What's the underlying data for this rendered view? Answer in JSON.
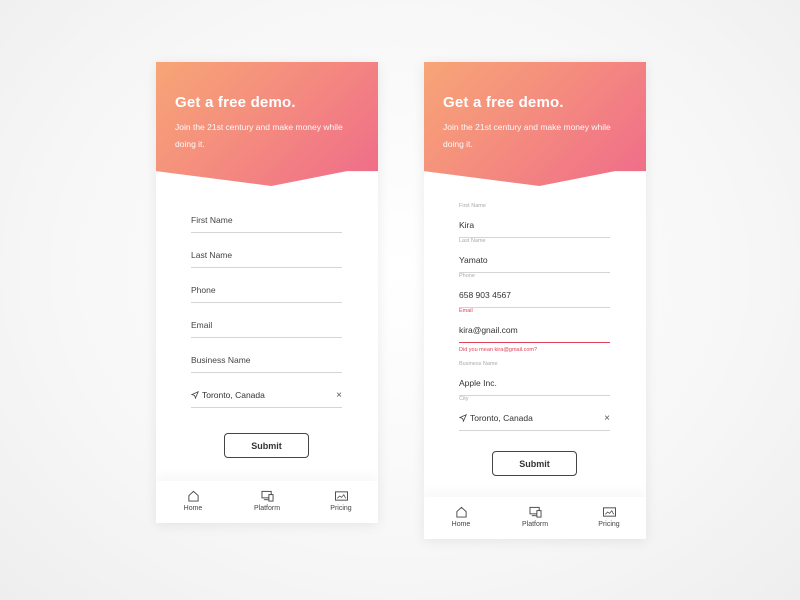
{
  "hero": {
    "title": "Get a free demo.",
    "subtitle": "Join the 21st century and make money while doing it."
  },
  "screen_a": {
    "fields": [
      {
        "placeholder": "First Name"
      },
      {
        "placeholder": "Last Name"
      },
      {
        "placeholder": "Phone"
      },
      {
        "placeholder": "Email"
      },
      {
        "placeholder": "Business Name"
      }
    ],
    "location": {
      "value": "Toronto, Canada",
      "clear": "×"
    },
    "submit": "Submit"
  },
  "screen_b": {
    "fields": [
      {
        "label": "First Name",
        "value": "Kira"
      },
      {
        "label": "Last Name",
        "value": "Yamato"
      },
      {
        "label": "Phone",
        "value": "658 903 4567"
      },
      {
        "label": "Email",
        "value": "kira@gnail.com",
        "error": true
      },
      {
        "label": "Business Name",
        "value": "Apple Inc."
      }
    ],
    "email_hint": "Did you mean kira@gmail.com?",
    "city": {
      "label": "City",
      "value": "Toronto, Canada",
      "clear": "×"
    },
    "submit": "Submit"
  },
  "tabs": [
    {
      "label": "Home",
      "icon": "home-icon"
    },
    {
      "label": "Platform",
      "icon": "devices-icon"
    },
    {
      "label": "Pricing",
      "icon": "pricing-icon"
    }
  ],
  "colors": {
    "gradient_start": "#f7a576",
    "gradient_end": "#ef6b8a",
    "error": "#e0435b"
  }
}
